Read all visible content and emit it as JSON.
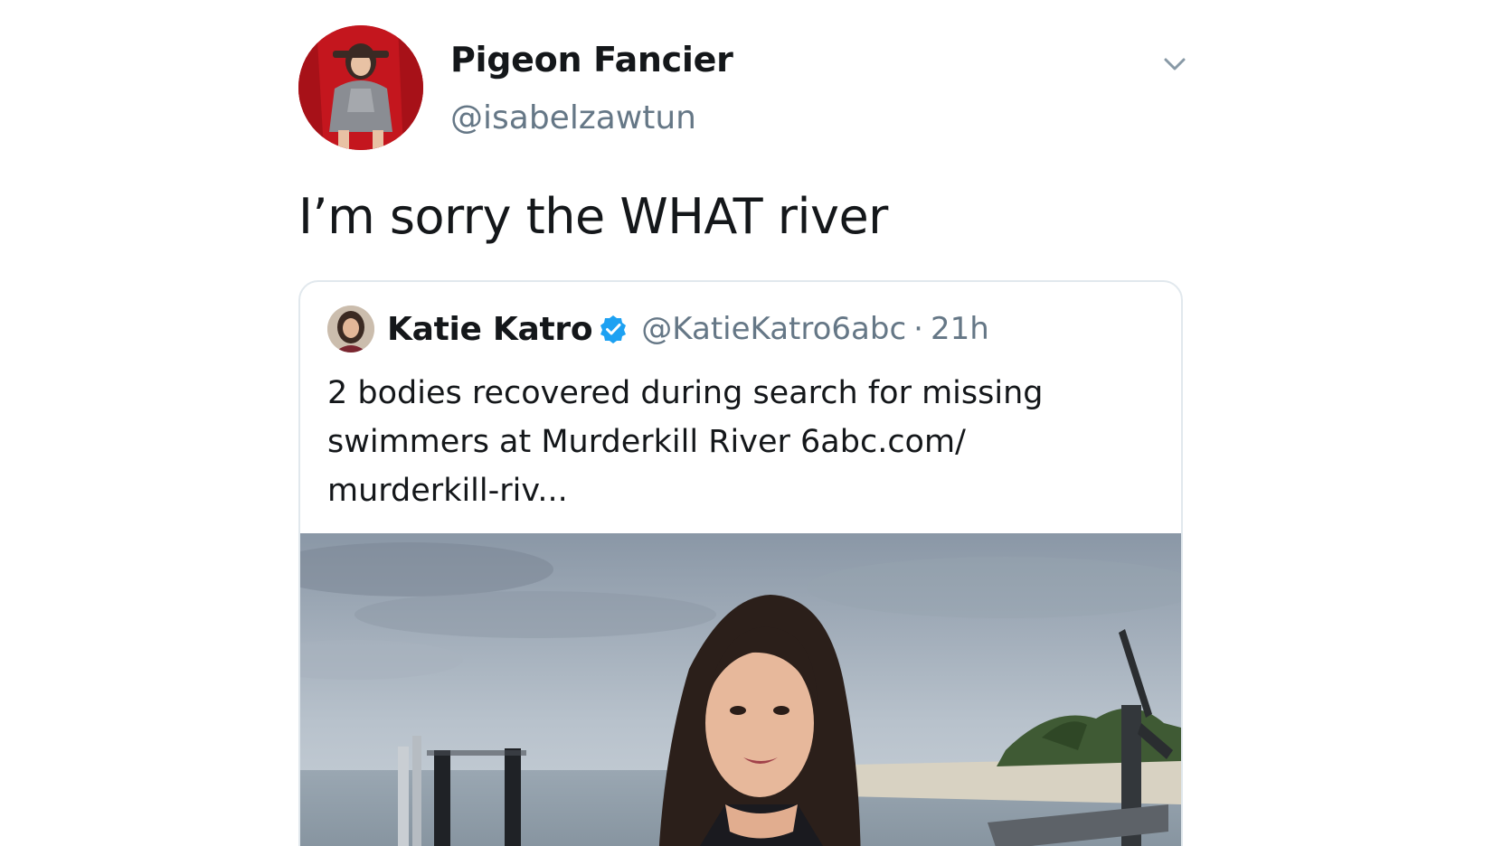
{
  "tweet": {
    "display_name": "Pigeon Fancier",
    "handle": "@isabelzawtun",
    "text": "I’m sorry the WHAT river",
    "avatar_icon": "profile-photo",
    "menu_icon": "chevron-down-icon"
  },
  "quoted_tweet": {
    "display_name": "Katie Katro",
    "handle": "@KatieKatro6abc",
    "separator": "·",
    "time": "21h",
    "verified_icon": "verified-badge-icon",
    "verified_color": "#1da1f2",
    "text_lines": [
      "2 bodies recovered during search for missing",
      "swimmers at Murderkill River 6abc.com/",
      "murderkill-riv..."
    ]
  },
  "colors": {
    "primary_text": "#14171a",
    "secondary_text": "#657786",
    "border": "#e1e8ed",
    "accent": "#1da1f2"
  }
}
